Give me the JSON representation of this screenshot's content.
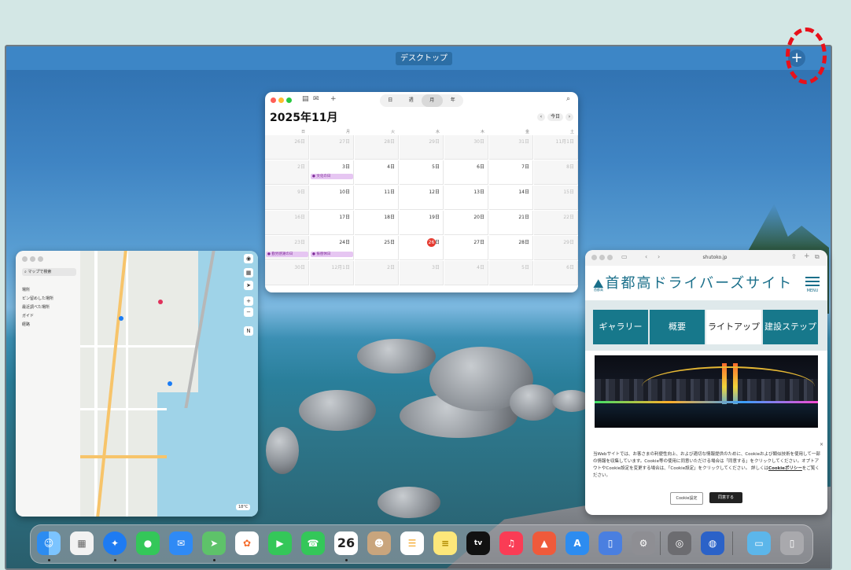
{
  "spaces": {
    "desktop_label": "デスクトップ",
    "add_symbol": "+"
  },
  "calendar": {
    "title": "2025年11月",
    "views": [
      "日",
      "週",
      "月",
      "年"
    ],
    "active_view": "月",
    "today_button": "今日",
    "weekdays": [
      "日",
      "月",
      "火",
      "水",
      "木",
      "金",
      "土"
    ],
    "weeks": [
      [
        "26日",
        "27日",
        "28日",
        "29日",
        "30日",
        "31日",
        "11月1日"
      ],
      [
        "2日",
        "3日",
        "4日",
        "5日",
        "6日",
        "7日",
        "8日"
      ],
      [
        "9日",
        "10日",
        "11日",
        "12日",
        "13日",
        "14日",
        "15日"
      ],
      [
        "16日",
        "17日",
        "18日",
        "19日",
        "20日",
        "21日",
        "22日"
      ],
      [
        "23日",
        "24日",
        "25日",
        "26日",
        "27日",
        "28日",
        "29日"
      ],
      [
        "30日",
        "12月1日",
        "2日",
        "3日",
        "4日",
        "5日",
        "6日"
      ]
    ],
    "today": "26",
    "events": {
      "culture_day": "文化の日",
      "labor_day": "勤労感謝の日",
      "substitute": "振替休日"
    }
  },
  "maps": {
    "search_placeholder": "マップで検索",
    "sidebar": [
      "場所",
      "ピン留めした場所",
      "最近調べた場所",
      "ガイド",
      "経路"
    ],
    "temperature": "18°C"
  },
  "safari": {
    "url": "shutoko.jp",
    "site_title": "首都高ドライバーズサイト",
    "logo_sub": "首都高",
    "menu_label": "MENU",
    "tabs": [
      "ギャラリー",
      "概要",
      "ライトアップ",
      "建設ステップ"
    ],
    "active_tab": "ライトアップ",
    "cookie_text": "当Webサイトでは、お客さまの利便性向上、および適切な情報提供のために、Cookieおよび類似技術を使用して一部の情報を収集しています。Cookie等の使用に同意いただける場合は「同意する」をクリックしてください。オプトアウトやCookie設定を変更する場合は、「Cookie設定」をクリックしてください。",
    "cookie_policy_prefix": "詳しくは",
    "cookie_policy_link": "Cookieポリシー",
    "cookie_policy_suffix": "をご覧ください。",
    "cookie_settings_button": "Cookie設定",
    "agree_button": "同意する"
  },
  "dock": {
    "apps": [
      "finder",
      "launchpad",
      "safari",
      "messages",
      "mail",
      "maps",
      "photos",
      "facetime",
      "phone",
      "calendar",
      "contacts",
      "reminders",
      "notes",
      "tv",
      "music",
      "keynote",
      "app-store",
      "simulator",
      "system-settings",
      "screenshot",
      "ollama",
      "downloads",
      "trash"
    ],
    "calendar_day": "26",
    "tv_label": "tv"
  },
  "colors": {
    "accent_red": "#e8101a",
    "shutoko_teal": "#17788b",
    "today_red": "#e53a30"
  }
}
